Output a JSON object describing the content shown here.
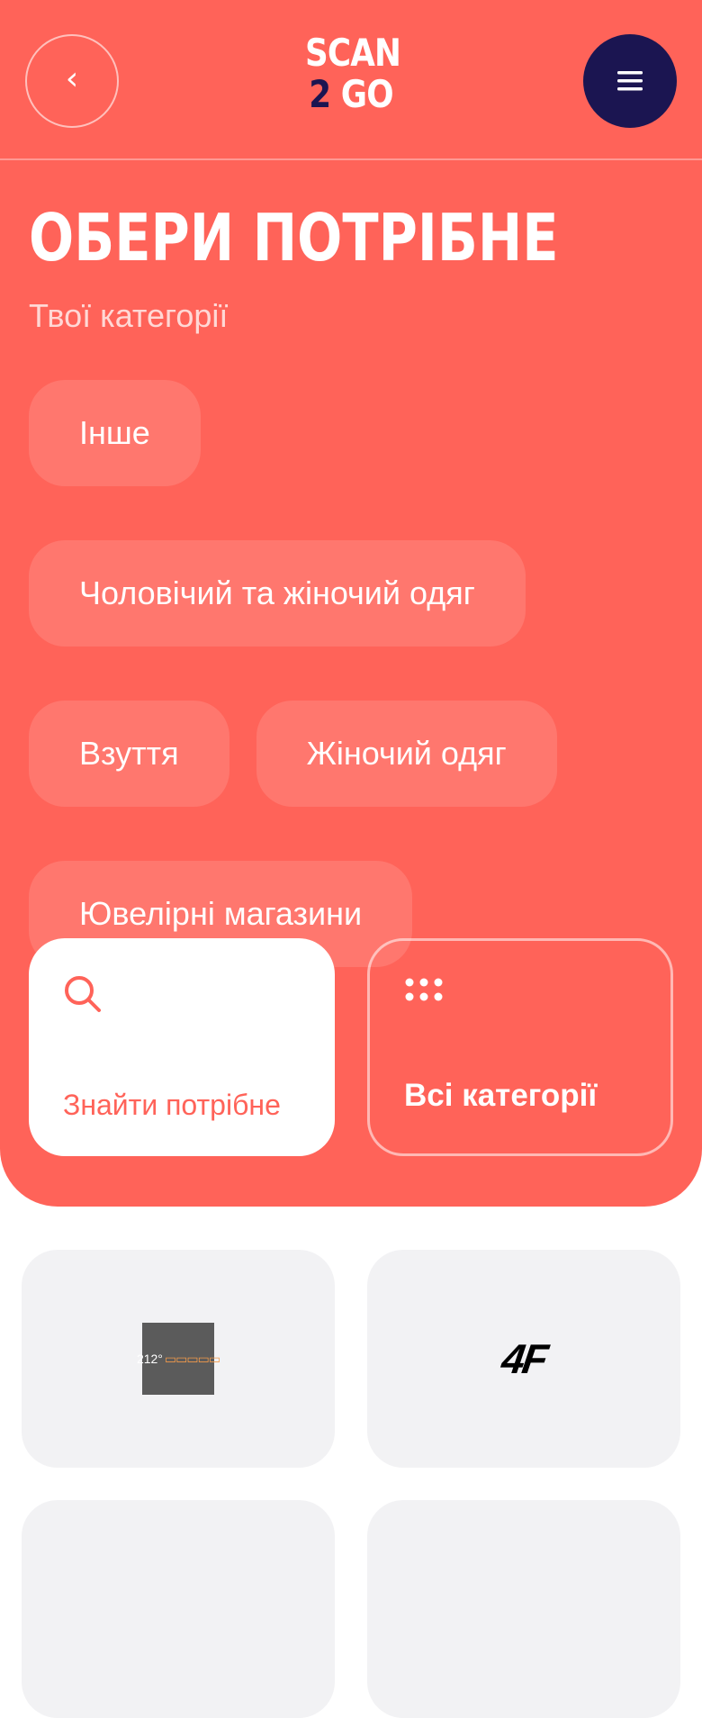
{
  "header": {
    "back_icon": "‹",
    "logo_line1": "SCAN",
    "logo_two": "2",
    "logo_go": "GO",
    "menu_icon": "hamburger-icon"
  },
  "page": {
    "title": "ОБЕРИ ПОТРІБНЕ",
    "subtitle": "Твої категорії"
  },
  "categories": [
    "Інше",
    "Чоловічий та жіночий одяг",
    "Взуття",
    "Жіночий одяг",
    "Ювелірні магазини"
  ],
  "actions": {
    "search_label": "Знайти потрібне",
    "all_label": "Всі категорії"
  },
  "stores": [
    {
      "logo_text": "212°",
      "logo_extra": "▭▭▭▭▭"
    },
    {
      "logo_text": "4F"
    }
  ],
  "colors": {
    "accent": "#ff6359",
    "navy": "#1b1551",
    "card_bg": "#f2f2f4"
  }
}
